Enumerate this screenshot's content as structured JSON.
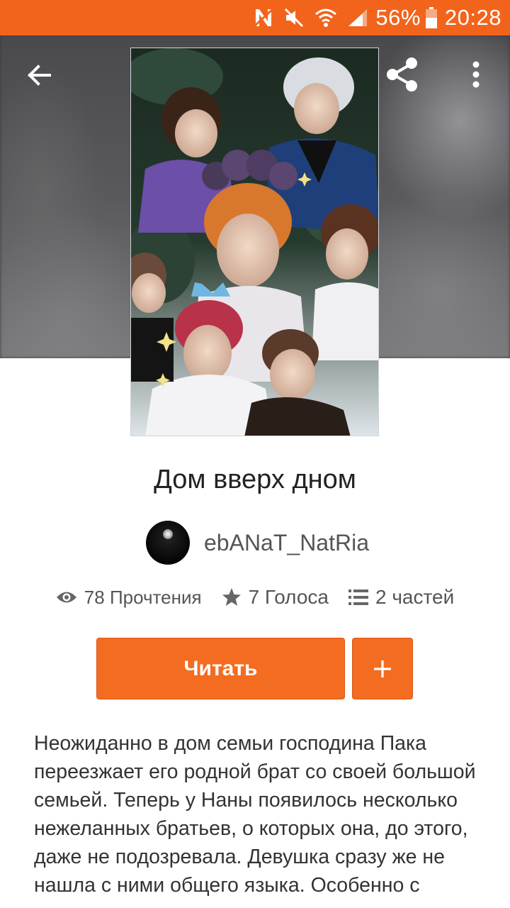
{
  "status_bar": {
    "battery_percent": "56%",
    "time": "20:28",
    "icons": [
      "n-notification-icon",
      "mute-icon",
      "wifi-icon",
      "signal-icon",
      "battery-icon"
    ]
  },
  "header": {
    "back_icon": "arrow-left-icon",
    "share_icon": "share-icon",
    "more_icon": "more-vertical-icon"
  },
  "story": {
    "title": "Дом вверх дном",
    "author": "ebANaT_NatRia",
    "stats": {
      "reads": "78 Прочтения",
      "votes": "7 Голоса",
      "parts": "2 частей"
    },
    "read_label": "Читать",
    "add_label": "+",
    "description_lines": [
      "Неожиданно в дом семьи господина Пака",
      "переезжает его родной брат со своей большой",
      "семьей. Теперь у Наны появилось несколько",
      "нежеланных братьев, о которых она, до этого,",
      "даже не подозревала. Девушка сразу же не",
      "нашла с ними общего языка. Особенно с"
    ]
  },
  "colors": {
    "accent": "#f2641c",
    "button": "#f46c1f",
    "text_dark": "#222222",
    "text_muted": "#555555"
  }
}
